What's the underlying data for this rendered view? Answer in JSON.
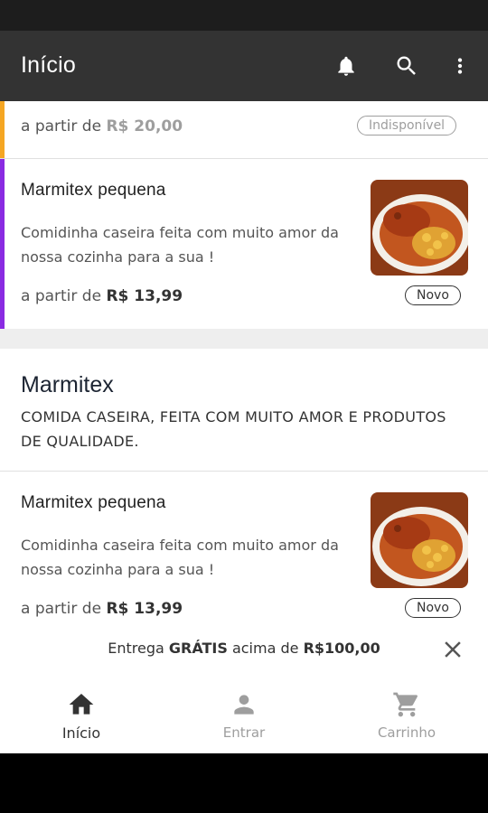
{
  "appbar": {
    "title": "Início",
    "actions": [
      "bell-icon",
      "search-icon",
      "more-vert-icon"
    ]
  },
  "items": [
    {
      "price_prefix": "a partir de",
      "price": "R$ 20,00",
      "badge": "Indisponível",
      "accent_color": "#f5a623"
    },
    {
      "title": "Marmitex pequena",
      "description": "Comidinha caseira feita com muito amor da nossa cozinha para a sua !",
      "price_prefix": "a partir de",
      "price": "R$ 13,99",
      "badge": "Novo",
      "accent_color": "#8a2be2"
    }
  ],
  "category": {
    "title": "Marmitex",
    "description": "COMIDA CASEIRA, FEITA COM MUITO AMOR E PRODUTOS DE QUALIDADE."
  },
  "category_items": [
    {
      "title": "Marmitex pequena",
      "description": "Comidinha caseira feita com muito amor da nossa cozinha para a sua !",
      "price_prefix": "a partir de",
      "price": "R$ 13,99",
      "badge": "Novo"
    }
  ],
  "promo": {
    "text_before": "Entrega ",
    "highlight": "GRÁTIS",
    "text_middle": " acima de ",
    "amount": "R$100,00"
  },
  "bottom_nav": [
    {
      "label": "Início",
      "icon": "home-icon",
      "active": true
    },
    {
      "label": "Entrar",
      "icon": "person-icon",
      "active": false
    },
    {
      "label": "Carrinho",
      "icon": "cart-icon",
      "active": false
    }
  ]
}
